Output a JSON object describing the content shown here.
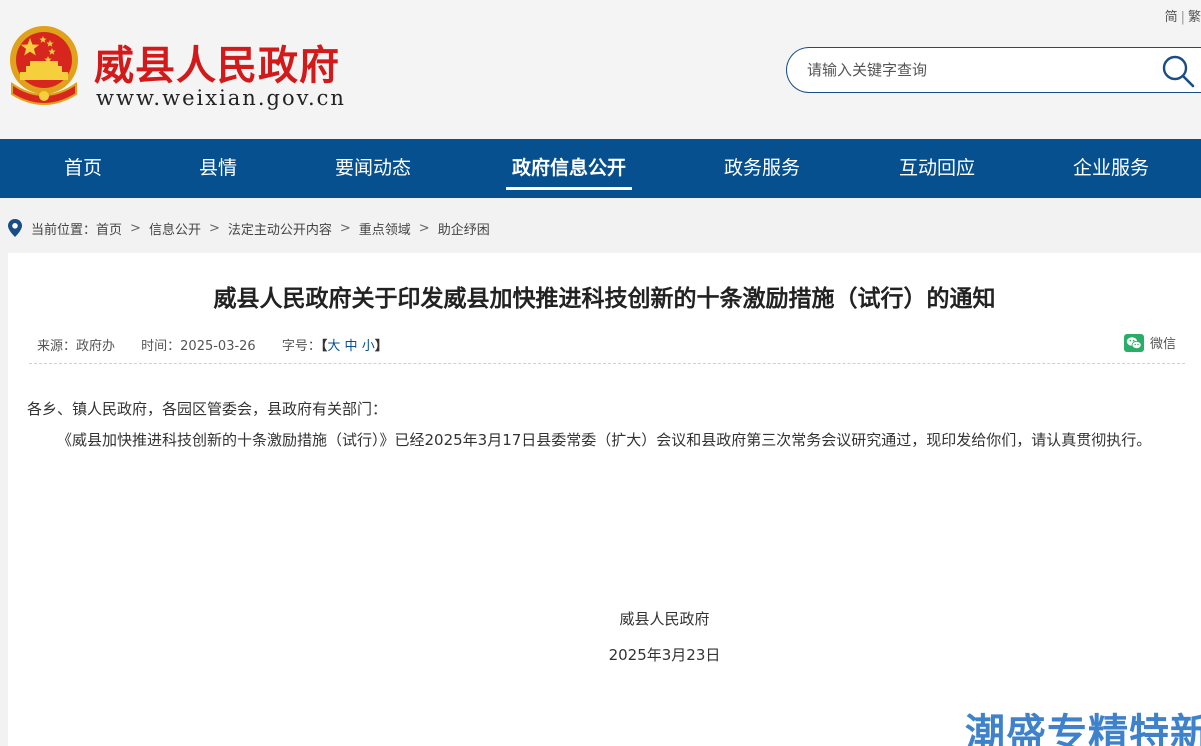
{
  "header": {
    "lang_simplified": "简",
    "lang_traditional": "繁",
    "site_title": "威县人民政府",
    "site_url": "www.weixian.gov.cn",
    "search_placeholder": "请输入关键字查询"
  },
  "nav": {
    "items": [
      {
        "label": "首页"
      },
      {
        "label": "县情"
      },
      {
        "label": "要闻动态"
      },
      {
        "label": "政府信息公开"
      },
      {
        "label": "政务服务"
      },
      {
        "label": "互动回应"
      },
      {
        "label": "企业服务"
      }
    ],
    "active": "政府信息公开"
  },
  "breadcrumb": {
    "prefix": "当前位置：",
    "items": [
      "首页",
      "信息公开",
      "法定主动公开内容",
      "重点领域",
      "助企纾困"
    ],
    "separator": ">"
  },
  "article": {
    "title": "威县人民政府关于印发威县加快推进科技创新的十条激励措施（试行）的通知",
    "source": "来源：政府办",
    "time": "时间：2025-03-26",
    "font_size_label": "字号：",
    "font_open": "【",
    "font_large": "大",
    "font_medium": "中",
    "font_small": "小",
    "font_close": "】",
    "share_label": "微信",
    "salutation": "各乡、镇人民政府，各园区管委会，县政府有关部门：",
    "paragraph": "《威县加快推进科技创新的十条激励措施（试行）》已经2025年3月17日县委常委（扩大）会议和县政府第三次常务会议研究通过，现印发给你们，请认真贯彻执行。",
    "signature": "威县人民政府",
    "date": "2025年3月23日"
  },
  "watermark": "潮盛专精特新",
  "colors": {
    "nav_bg": "#06508f",
    "title_red": "#d21a1a",
    "accent_blue": "#1a4c86",
    "wechat_green": "#2aae67"
  },
  "icons": [
    "national-emblem",
    "search-icon",
    "location-pin-icon",
    "wechat-icon"
  ]
}
